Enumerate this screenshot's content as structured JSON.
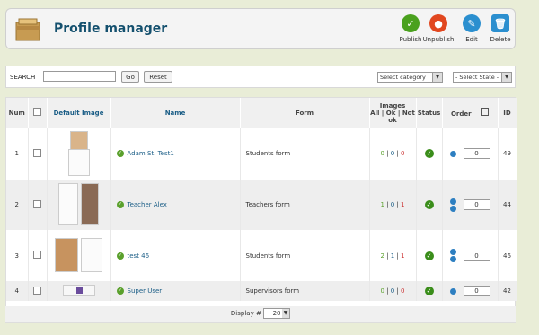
{
  "header": {
    "title": "Profile manager"
  },
  "toolbar": [
    {
      "label": "Publish",
      "icon": "publish-icon",
      "color": "#4aa11e"
    },
    {
      "label": "Unpublish",
      "icon": "unpublish-icon",
      "color": "#e1471f"
    },
    {
      "label": "Edit",
      "icon": "edit-icon",
      "color": "#2b8fcf"
    },
    {
      "label": "Delete",
      "icon": "delete-icon",
      "color": "#2b8fcf"
    }
  ],
  "filter": {
    "search_label": "SEARCH",
    "search_value": "",
    "go_label": "Go",
    "reset_label": "Reset",
    "category_select": "Select category",
    "state_select": "- Select State -"
  },
  "table": {
    "headers": {
      "num": "Num",
      "default_image": "Default Image",
      "name": "Name",
      "form": "Form",
      "images": "Images",
      "images_sub": "All | Ok | Not ok",
      "status": "Status",
      "order": "Order",
      "id": "ID"
    },
    "rows": [
      {
        "num": "1",
        "name": "Adam St. Test1",
        "form": "Students form",
        "all": "0",
        "ok": "0",
        "not_ok": "0",
        "order": "0",
        "id": "49"
      },
      {
        "num": "2",
        "name": "Teacher Alex",
        "form": "Teachers form",
        "all": "1",
        "ok": "0",
        "not_ok": "1",
        "order": "0",
        "id": "44"
      },
      {
        "num": "3",
        "name": "test 46",
        "form": "Students form",
        "all": "2",
        "ok": "1",
        "not_ok": "1",
        "order": "0",
        "id": "46"
      },
      {
        "num": "4",
        "name": "Super User",
        "form": "Supervisors form",
        "all": "0",
        "ok": "0",
        "not_ok": "0",
        "order": "0",
        "id": "42"
      }
    ]
  },
  "footer": {
    "display_label": "Display #",
    "display_value": "20"
  }
}
